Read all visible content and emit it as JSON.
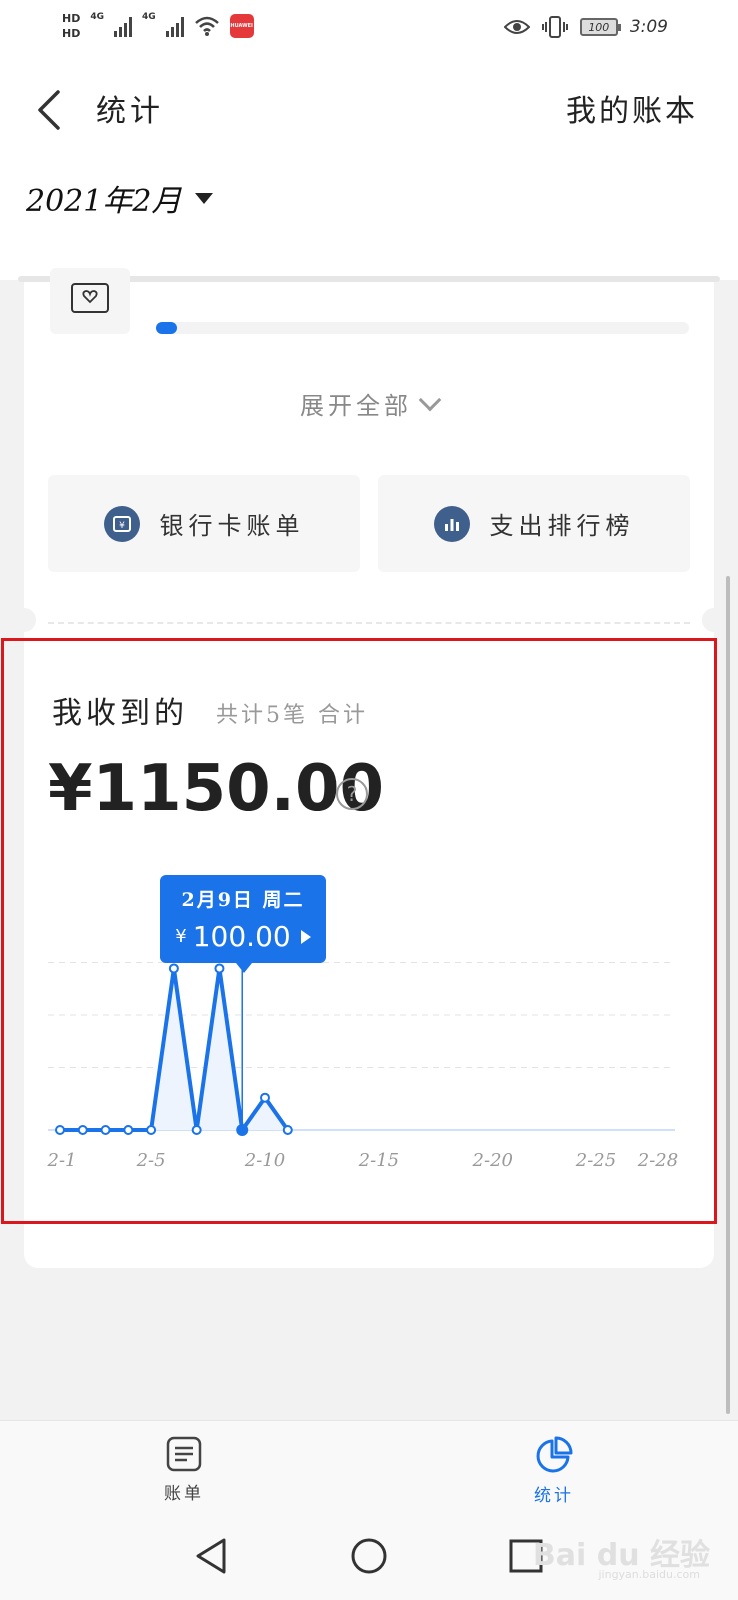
{
  "status_bar": {
    "hd1": "HD",
    "hd2": "HD",
    "net1": "4G",
    "net2": "4G",
    "app_badge": "HUAWEI",
    "battery": "100",
    "time": "3:09"
  },
  "header": {
    "title": "统计",
    "book_link": "我的账本",
    "month": "2021年2月"
  },
  "category": {
    "progress_fraction": 0.04
  },
  "expand_all_label": "展开全部",
  "actions": {
    "bank_label": "银行卡账单",
    "rank_label": "支出排行榜"
  },
  "income": {
    "title": "我收到的",
    "subtitle": "共计5笔 合计",
    "total": "¥1150.00",
    "help": "?"
  },
  "tooltip": {
    "date": "2月9日 周二",
    "currency": "¥",
    "amount": "100.00"
  },
  "chart_data": {
    "type": "line",
    "x_tick_labels": [
      "2-1",
      "2-5",
      "2-10",
      "2-15",
      "2-20",
      "2-25",
      "2-28"
    ],
    "x_tick_days": [
      1,
      5,
      10,
      15,
      20,
      25,
      28
    ],
    "x": [
      1,
      2,
      3,
      4,
      5,
      6,
      7,
      8,
      9,
      10,
      11
    ],
    "values": [
      0,
      0,
      0,
      0,
      0,
      500,
      0,
      500,
      0,
      100,
      0
    ],
    "highlight_x": 9,
    "xlim": [
      1,
      28
    ],
    "ylim": [
      0,
      650
    ],
    "grid": true,
    "colors": {
      "line": "#1a73e8",
      "fill": "#eef4fd",
      "grid": "#e3e3e3",
      "axis": "#cfe0f7"
    }
  },
  "bottom_nav": {
    "bills": "账单",
    "stats": "统计",
    "active_color": "#1a73e8"
  },
  "watermark": {
    "main": "Bai du 经验",
    "sub": "jingyan.baidu.com"
  }
}
